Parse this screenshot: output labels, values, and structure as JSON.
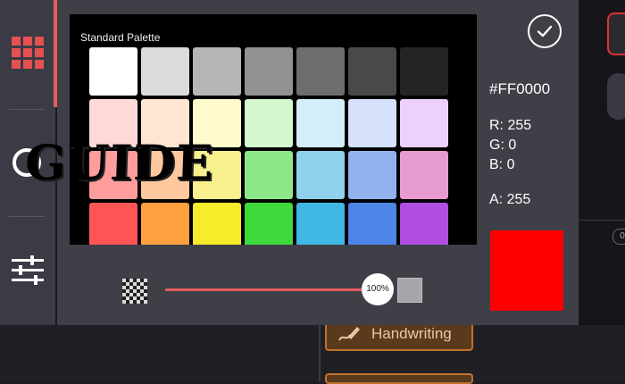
{
  "background": {
    "handwriting_label": "Handwriting",
    "badge_text": "0"
  },
  "rail": {
    "items": [
      {
        "icon": "grid-icon",
        "active": true
      },
      {
        "icon": "ring-icon"
      },
      {
        "icon": "sliders-icon"
      }
    ],
    "accent_color": "#E35C5C"
  },
  "palette": {
    "title": "Standard Palette",
    "rows": [
      [
        "#FFFFFF",
        "#DBDBDB",
        "#B6B6B6",
        "#929292",
        "#6D6D6D",
        "#494949",
        "#242424"
      ],
      [
        "#FFD9D9",
        "#FFE6D2",
        "#FFFBCC",
        "#D4F7CE",
        "#D4EEF9",
        "#D6E1FB",
        "#ECD2FB"
      ],
      [
        "#FF9D9D",
        "#FFC89E",
        "#F8F08E",
        "#8EE88A",
        "#8FD1EA",
        "#92B2EE",
        "#E89BD0"
      ],
      [
        "#FF5555",
        "#FFA03F",
        "#F6EC2A",
        "#3ED93B",
        "#41B7E3",
        "#4E85E8",
        "#B04EE2"
      ]
    ]
  },
  "selection": {
    "hex": "#FF0000",
    "r_label": "R: 255",
    "g_label": "G: 0",
    "b_label": "B: 0",
    "a_label": "A: 255",
    "preview_color": "#FF0000"
  },
  "alpha": {
    "percent_label": "100%",
    "value_fraction": 1.0
  },
  "watermark": "GUIDE"
}
